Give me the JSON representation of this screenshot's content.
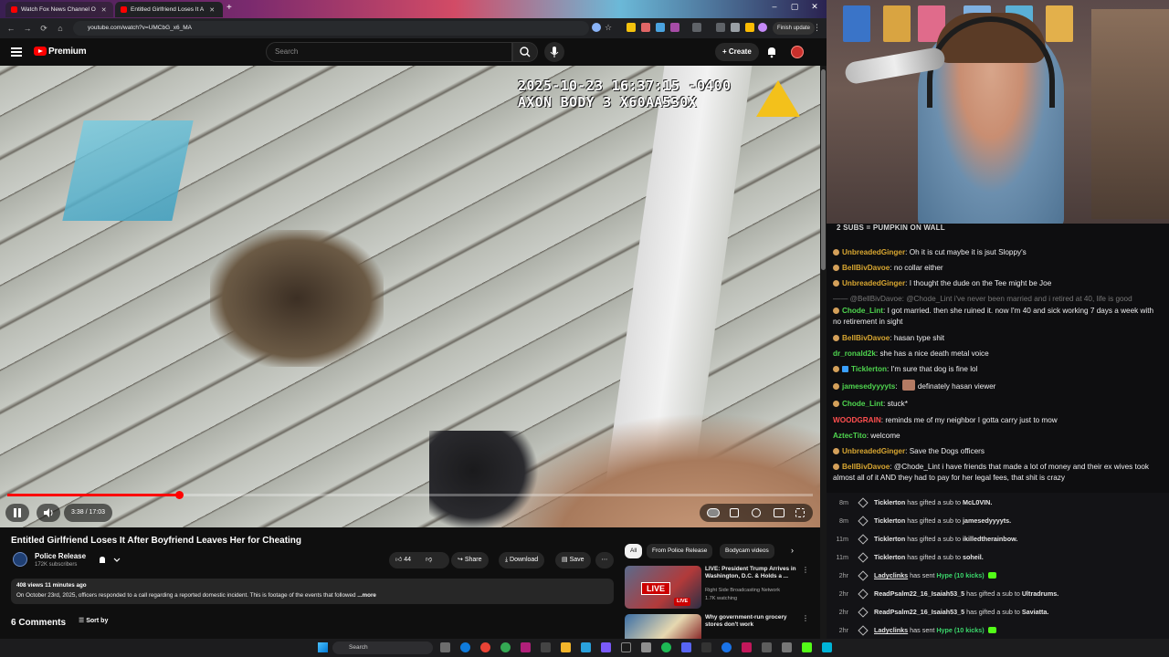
{
  "browser": {
    "tabs": [
      {
        "label": "Watch Fox News Channel O",
        "active": false
      },
      {
        "label": "Entitled Girlfriend Loses It A",
        "active": true
      }
    ],
    "url": "youtube.com/watch?v=UMCbG_x6_MA",
    "finish_update_label": "Finish update"
  },
  "youtube": {
    "brand": "Premium",
    "search_placeholder": "Search",
    "create_label": "+ Create",
    "video": {
      "overlay_line1": "2025-10-23 16:37:15 -0400",
      "overlay_line2": "AXON BODY 3 X60AA530X",
      "current_time": "3:38",
      "duration": "17:03",
      "time_display": "3:38 / 17:03",
      "progress": 0.2131
    },
    "title": "Entitled Girlfriend Loses It After Boyfriend Leaves Her for Cheating",
    "channel": {
      "name": "Police Release",
      "subscribers": "172K subscribers"
    },
    "actions": {
      "likes": "44",
      "share": "Share",
      "download": "Download",
      "save": "Save"
    },
    "description": {
      "meta": "408 views  11 minutes ago",
      "text": "On October 23rd, 2025, officers responded to a call regarding a reported domestic incident. This is footage of the events that followed",
      "more": " ...more"
    },
    "comments": {
      "count_label": "6 Comments",
      "sort_label": "Sort by"
    },
    "chips": [
      "All",
      "From Police Release",
      "Bodycam videos"
    ],
    "recommendations": [
      {
        "title": "LIVE: President Trump Arrives in Washington, D.C. & Holds a ...",
        "channel": "Right Side Broadcasting Network",
        "meta": "1.7K watching",
        "badge": "LIVE",
        "thumb_label": "LIVE"
      },
      {
        "title": "Why government-run grocery stores don't work",
        "channel": "",
        "meta": "",
        "badge": "",
        "thumb_label": ""
      }
    ]
  },
  "chat": {
    "banner": "2 SUBS = PUMPKIN ON WALL",
    "messages": [
      {
        "user": "UnbreadedGinger",
        "color": "#d8a631",
        "badge": "sub",
        "text": "Oh it is cut maybe it is jsut Sloppy's"
      },
      {
        "user": "BellBivDavoe",
        "color": "#d8a631",
        "badge": "sub",
        "text": "no collar either"
      },
      {
        "user": "UnbreadedGinger",
        "color": "#d8a631",
        "badge": "sub",
        "text": "I thought the dude on the Tee might be Joe"
      },
      {
        "user": "",
        "color": "#777777",
        "badge": "",
        "text": "@BellBivDavoe: @Chode_Lint i've never been married and i retired at 40, life is good",
        "faded": true
      },
      {
        "user": "Chode_Lint",
        "color": "#4fd64f",
        "badge": "sub",
        "text": "I got married. then she ruined it. now I'm 40 and sick working 7 days a week with no retirement in sight"
      },
      {
        "user": "BellBivDavoe",
        "color": "#d8a631",
        "badge": "sub",
        "text": "hasan type shit"
      },
      {
        "user": "dr_ronald2k",
        "color": "#4fd64f",
        "badge": "",
        "text": "she has a nice death metal voice"
      },
      {
        "user": "Ticklerton",
        "color": "#4fd64f",
        "badge": "both",
        "text": "I'm sure that dog is fine lol"
      },
      {
        "user": "jamesedyyyyts",
        "color": "#4fd64f",
        "badge": "sub",
        "text": "definately hasan viewer",
        "emote": true
      },
      {
        "user": "Chode_Lint",
        "color": "#4fd64f",
        "badge": "sub",
        "text": "stuck*"
      },
      {
        "user": "WOODGRAIN",
        "color": "#ff4f4f",
        "badge": "",
        "text": "reminds me of my neighbor I gotta carry just to mow"
      },
      {
        "user": "AztecTito",
        "color": "#4fd64f",
        "badge": "",
        "text": "welcome"
      },
      {
        "user": "UnbreadedGinger",
        "color": "#d8a631",
        "badge": "sub",
        "text": "Save the Dogs officers"
      },
      {
        "user": "BellBivDavoe",
        "color": "#d8a631",
        "badge": "sub",
        "text": "@Chode_Lint i have friends that made a lot of money and their ex wives took almost all of it AND they had to pay for her legal fees, that shit is crazy"
      }
    ],
    "events": [
      {
        "ago": "8m",
        "who": "Ticklerton",
        "action": "has gifted a sub to",
        "target": "McL0VIN.",
        "extra": ""
      },
      {
        "ago": "8m",
        "who": "Ticklerton",
        "action": "has gifted a sub to",
        "target": "jamesedyyyyts.",
        "extra": ""
      },
      {
        "ago": "11m",
        "who": "Ticklerton",
        "action": "has gifted a sub to",
        "target": "ikilledtherainbow.",
        "extra": ""
      },
      {
        "ago": "11m",
        "who": "Ticklerton",
        "action": "has gifted a sub to",
        "target": "soheil.",
        "extra": ""
      },
      {
        "ago": "2hr",
        "who": "Ladyclinks",
        "action": "has sent",
        "target": "",
        "extra": "Hype (10 kicks)"
      },
      {
        "ago": "2hr",
        "who": "ReadPsalm22_16_Isaiah53_5",
        "action": "has gifted a sub to",
        "target": "Ultradrums.",
        "extra": ""
      },
      {
        "ago": "2hr",
        "who": "ReadPsalm22_16_Isaiah53_5",
        "action": "has gifted a sub to",
        "target": "Saviatta.",
        "extra": ""
      },
      {
        "ago": "2hr",
        "who": "Ladyclinks",
        "action": "has sent",
        "target": "",
        "extra": "Hype (10 kicks)"
      }
    ]
  },
  "taskbar": {
    "search_placeholder": "Search"
  }
}
